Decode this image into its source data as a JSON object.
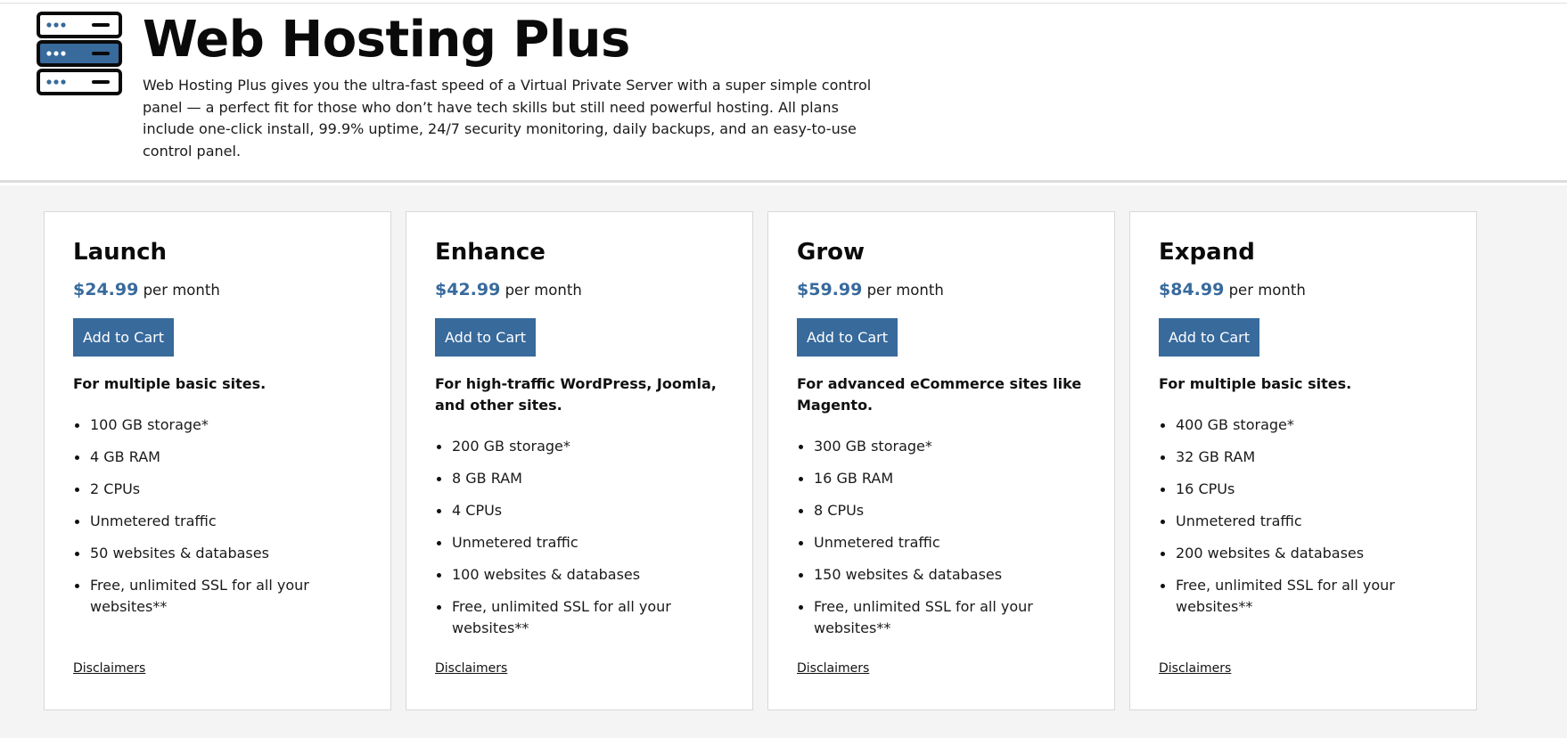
{
  "header": {
    "icon": "server-stack-icon",
    "title": "Web Hosting Plus",
    "description": "Web Hosting Plus gives you the ultra-fast speed of a Virtual Private Server with a super simple control panel — a perfect fit for those who don’t have tech skills but still need powerful hosting. All plans include one-click install, 99.9% uptime, 24/7 security monitoring, daily backups, and an easy-to-use control panel."
  },
  "colors": {
    "accent": "#386a9c",
    "page_background": "#f4f4f4",
    "card_background": "#ffffff"
  },
  "plans": [
    {
      "name": "Launch",
      "price": "$24.99",
      "period": "per month",
      "button_label": "Add to Cart",
      "tagline": "For multiple basic sites.",
      "features": [
        "100 GB storage*",
        "4 GB RAM",
        "2 CPUs",
        "Unmetered traffic",
        "50 websites & databases",
        "Free, unlimited SSL for all your websites**"
      ],
      "disclaimers_label": "Disclaimers"
    },
    {
      "name": "Enhance",
      "price": "$42.99",
      "period": "per month",
      "button_label": "Add to Cart",
      "tagline": "For high-traffic WordPress, Joomla, and other sites.",
      "features": [
        "200 GB storage*",
        "8 GB RAM",
        "4 CPUs",
        "Unmetered traffic",
        "100 websites & databases",
        "Free, unlimited SSL for all your websites**"
      ],
      "disclaimers_label": "Disclaimers"
    },
    {
      "name": "Grow",
      "price": "$59.99",
      "period": "per month",
      "button_label": "Add to Cart",
      "tagline": "For advanced eCommerce sites like Magento.",
      "features": [
        "300 GB storage*",
        "16 GB RAM",
        "8 CPUs",
        "Unmetered traffic",
        "150 websites & databases",
        "Free, unlimited SSL for all your websites**"
      ],
      "disclaimers_label": "Disclaimers"
    },
    {
      "name": "Expand",
      "price": "$84.99",
      "period": "per month",
      "button_label": "Add to Cart",
      "tagline": "For multiple basic sites.",
      "features": [
        "400 GB storage*",
        "32 GB RAM",
        "16 CPUs",
        "Unmetered traffic",
        "200 websites & databases",
        "Free, unlimited SSL for all your websites**"
      ],
      "disclaimers_label": "Disclaimers"
    }
  ]
}
